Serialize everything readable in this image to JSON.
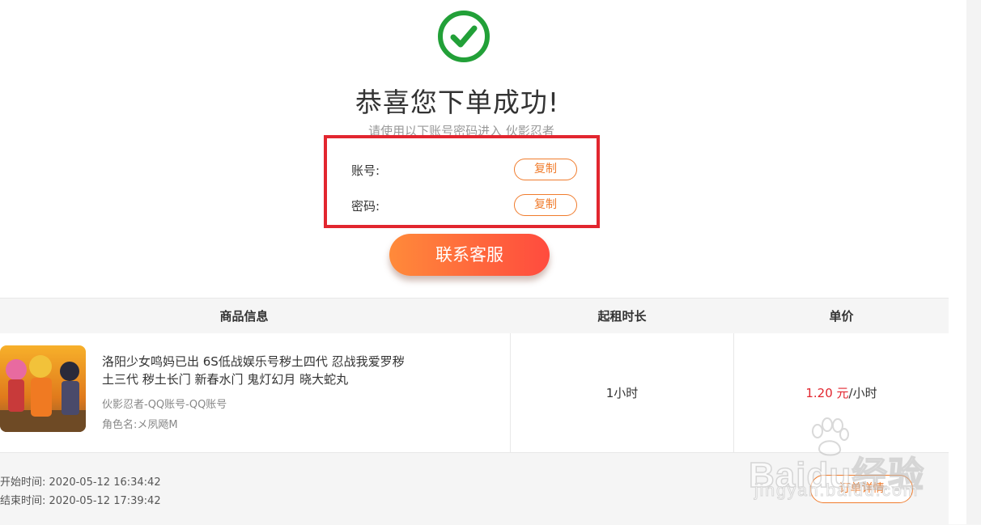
{
  "success": {
    "icon": "check-circle-icon",
    "title": "恭喜您下单成功!",
    "hint": "请使用以下账号密码进入 伙影忍者"
  },
  "credentials": {
    "account_label": "账号:",
    "account_value": "",
    "password_label": "密码:",
    "password_value": "",
    "copy_label": "复制"
  },
  "contact_button": "联系客服",
  "table": {
    "headers": [
      "商品信息",
      "起租时长",
      "单价"
    ],
    "product": {
      "image": "product-thumbnail",
      "title": "洛阳少女鸣妈已出 6S低战娱乐号秽土四代 忍战我爱罗秽土三代 秽土长门 新春水门 鬼灯幻月 晓大蛇丸",
      "category": "伙影忍者-QQ账号-QQ账号",
      "role": "角色名:メ夙飏M"
    },
    "duration": "1小时",
    "price_amount": "1.20 元",
    "price_unit": "/小时"
  },
  "footer": {
    "start_label": "开始时间:",
    "start_time": "2020-05-12 16:34:42",
    "end_label": "结束时间:",
    "end_time": "2020-05-12 17:39:42",
    "order_detail_button": "订单详情"
  },
  "watermark": {
    "brand": "Baidu经验",
    "url": "jingyan.baidu.com"
  },
  "colors": {
    "accent_orange": "#f07c2d",
    "highlight_red": "#e2262f",
    "success_green": "#22a038"
  }
}
